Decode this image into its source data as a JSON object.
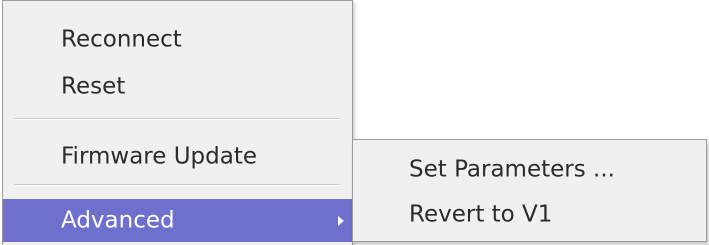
{
  "context_menu": {
    "items": [
      {
        "label": "Reconnect"
      },
      {
        "label": "Reset"
      },
      {
        "label": "Firmware Update"
      },
      {
        "label": "Advanced",
        "has_submenu": true,
        "highlighted": true
      }
    ]
  },
  "submenu": {
    "items": [
      {
        "label": "Set Parameters ..."
      },
      {
        "label": "Revert to V1"
      }
    ]
  },
  "colors": {
    "menu_background": "#f0f0f0",
    "highlight": "#6f6fce",
    "text": "#2b2b2b",
    "highlight_text": "#ffffff",
    "border": "#9c9c9c"
  },
  "icons": {
    "submenu_arrow": "chevron-right-icon"
  }
}
